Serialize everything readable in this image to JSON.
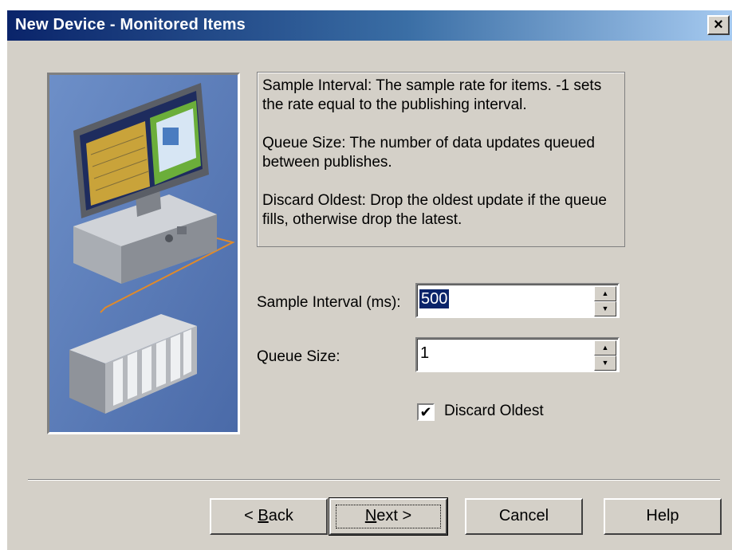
{
  "window": {
    "title": "New Device - Monitored Items",
    "close_glyph": "×"
  },
  "description": {
    "sample_interval": "Sample Interval: The sample rate for items. -1 sets the rate equal to the publishing interval.",
    "queue_size": "Queue Size: The number of data updates queued between publishes.",
    "discard_oldest": "Discard Oldest: Drop the oldest update if the queue fills, otherwise drop the latest."
  },
  "fields": {
    "sample_interval": {
      "label": "Sample Interval (ms):",
      "value": "500"
    },
    "queue_size": {
      "label": "Queue Size:",
      "value": "1"
    }
  },
  "checkbox": {
    "label": "Discard Oldest",
    "checked": true,
    "mark": "✔"
  },
  "buttons": {
    "back": {
      "prefix": "< ",
      "accel": "B",
      "rest": "ack"
    },
    "next": {
      "accel": "N",
      "rest": "ext >"
    },
    "cancel": "Cancel",
    "help": "Help"
  },
  "spinner": {
    "up": "▲",
    "down": "▼"
  },
  "colors": {
    "title_gradient_start": "#0a246a",
    "dialog_face": "#d4d0c8",
    "illustration_bg": "#5a7fba",
    "selection": "#0a246a"
  },
  "icons": [
    "device-illustration",
    "close-icon",
    "spin-up-icon",
    "spin-down-icon",
    "checkmark-icon"
  ]
}
